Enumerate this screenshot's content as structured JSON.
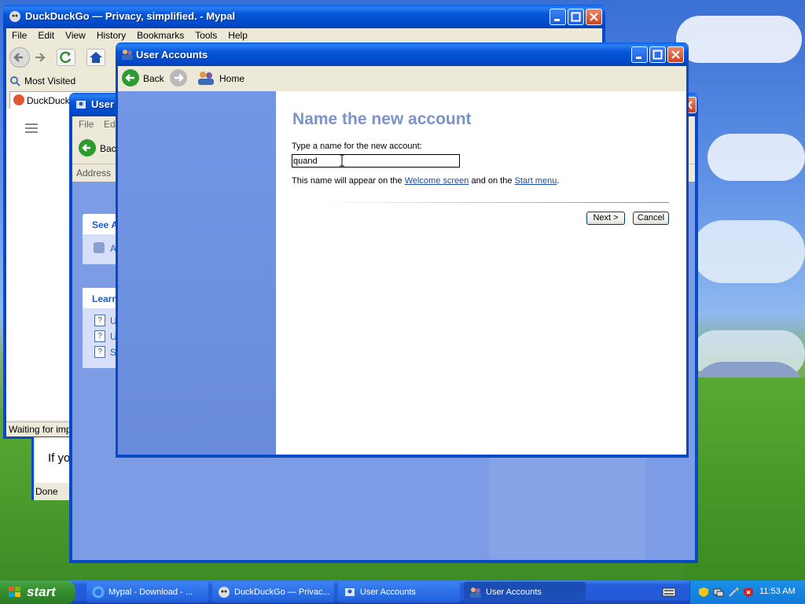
{
  "browser": {
    "title": "DuckDuckGo — Privacy, simplified. - Mypal",
    "menu": [
      "File",
      "Edit",
      "View",
      "History",
      "Bookmarks",
      "Tools",
      "Help"
    ],
    "bookmark": "Most Visited",
    "tab": "DuckDuckGo",
    "status": "Waiting for impr",
    "page_text": "If yo",
    "status2": "Done"
  },
  "bg_window": {
    "title": "User",
    "menu": [
      "File",
      "Edi"
    ],
    "back": "Back",
    "address_label": "Address",
    "see_also": "See A",
    "see_item": "A",
    "learn": "Learn",
    "learn_items": [
      "U",
      "U",
      "S"
    ]
  },
  "dialog": {
    "title": "User Accounts",
    "back_label": "Back",
    "home_label": "Home",
    "heading": "Name the new account",
    "prompt": "Type a name for the new account:",
    "input_value": "quand",
    "hint_prefix": "This name will appear on the ",
    "hint_link1": "Welcome screen",
    "hint_mid": " and on the ",
    "hint_link2": "Start menu",
    "hint_suffix": ".",
    "next_label": "Next >",
    "cancel_label": "Cancel"
  },
  "taskbar": {
    "start": "start",
    "items": [
      {
        "label": "Mypal - Download - ..."
      },
      {
        "label": "DuckDuckGo — Privac..."
      },
      {
        "label": "User Accounts"
      },
      {
        "label": "User Accounts"
      }
    ],
    "clock": "11:53 AM"
  },
  "colors": {
    "accent": "#0a49c4",
    "heading": "#7a93c9",
    "link": "#1a4aa8",
    "panel": "#6e8ee0"
  }
}
